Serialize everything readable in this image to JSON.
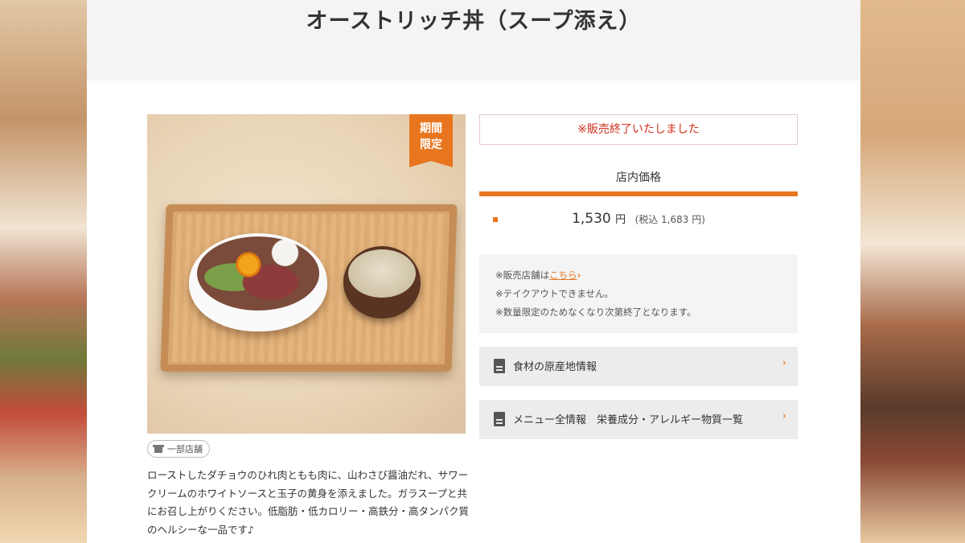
{
  "header": {
    "title": "オーストリッチ丼（スープ添え）"
  },
  "product": {
    "ribbon_line1": "期間",
    "ribbon_line2": "限定",
    "store_badge": "一部店舗",
    "description": "ローストしたダチョウのひれ肉ともも肉に、山わさび醤油だれ、サワークリームのホワイトソースと玉子の黄身を添えました。ガラスープと共にお召し上がりください。低脂肪・低カロリー・高鉄分・高タンパク質のヘルシーな一品です♪"
  },
  "status": {
    "sold_out": "※販売終了いたしました"
  },
  "price": {
    "heading": "店内価格",
    "amount": "1,530",
    "unit": "円",
    "tax_included": "(税込 1,683 円)"
  },
  "notes": {
    "store_prefix": "※販売店舗は",
    "store_link": "こちら",
    "takeout": "※テイクアウトできません。",
    "limited": "※数量限定のためなくなり次第終了となります。"
  },
  "links": {
    "origin_info": "食材の原産地情報",
    "menu_info": "メニュー全情報　栄養成分・アレルギー物質一覧"
  },
  "colors": {
    "accent": "#e8761f",
    "sold_out_text": "#d0311e"
  },
  "icons": {
    "document": "document-icon",
    "chevron": "chevron-right-icon",
    "store": "store-icon"
  }
}
